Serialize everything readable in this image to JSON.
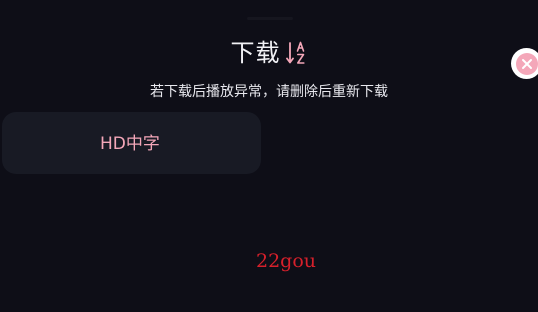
{
  "header": {
    "title": "下载",
    "sort_icon": "sort-az-icon",
    "close_icon": "close-icon"
  },
  "hint": "若下载后播放异常，请删除后重新下载",
  "qualities": [
    {
      "label": "HD中字"
    }
  ],
  "watermark": "22gou",
  "colors": {
    "background": "#0e0e17",
    "card": "#181a24",
    "accent": "#f4a7b9",
    "watermark": "#d6202b"
  }
}
